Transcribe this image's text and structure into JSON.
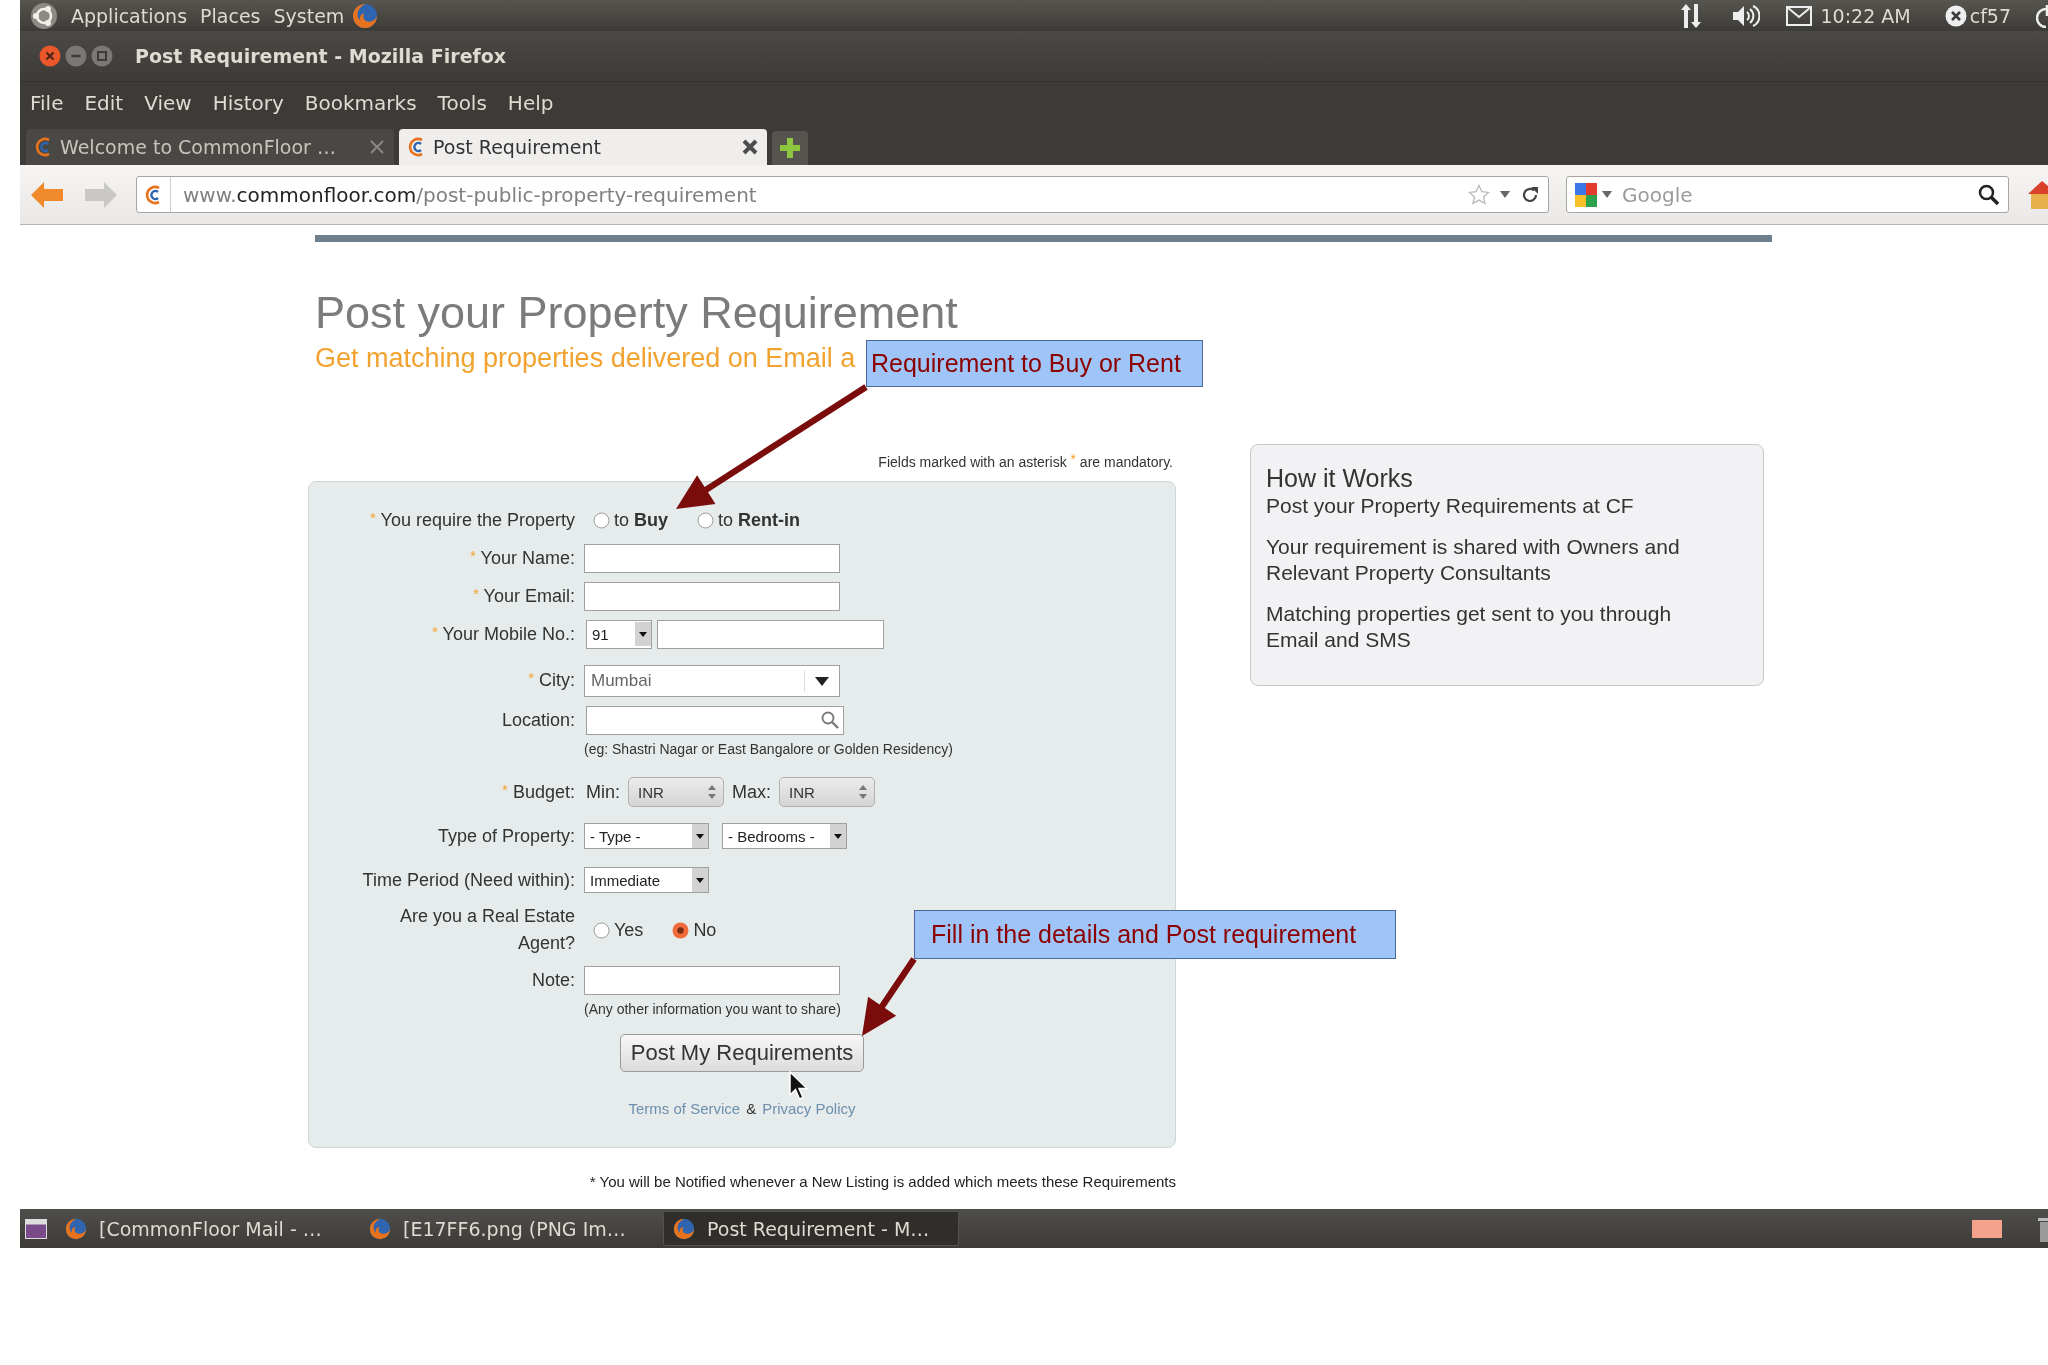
{
  "top_panel": {
    "menus": [
      "Applications",
      "Places",
      "System"
    ],
    "clock": "10:22 AM",
    "user": "cf57"
  },
  "window": {
    "title": "Post Requirement - Mozilla Firefox"
  },
  "menu_bar": [
    "File",
    "Edit",
    "View",
    "History",
    "Bookmarks",
    "Tools",
    "Help"
  ],
  "tabs": [
    {
      "label": "Welcome to CommonFloor …",
      "selected": false
    },
    {
      "label": "Post Requirement",
      "selected": true
    }
  ],
  "nav_buttons": [
    {
      "kind": "back",
      "disabled": false
    },
    {
      "kind": "forward",
      "disabled": true
    }
  ],
  "address_bar": {
    "url": [
      {
        "kind": "plain",
        "text": "www."
      },
      {
        "kind": "domain",
        "text": "commonfloor.com"
      },
      {
        "kind": "plain",
        "text": "/post-public-property-requirement"
      }
    ]
  },
  "search": {
    "placeholder": "Google"
  },
  "page": {
    "title": "Post your Property Requirement",
    "subtitle": "Get matching properties delivered on Email a",
    "mandatory_note": "Fields marked with an asterisk $^{*}$ are mandatory.",
    "form": {
      "rows": [
        {
          "kind": "radio",
          "label": "$^{*}$ You require the Property",
          "options": [
            {
              "label": "to **Buy**",
              "selected": false
            },
            {
              "label": "to **Rent-in**",
              "selected": false
            }
          ]
        },
        {
          "kind": "text",
          "label": "$^{*}$ Your Name:"
        },
        {
          "kind": "text",
          "label": "$^{*}$ Your Email:"
        },
        {
          "kind": "phone",
          "label": "$^{*}$ Your Mobile No.:",
          "code": "91"
        },
        {
          "kind": "combo",
          "label": "$^{*}$ City:",
          "value": "Mumbai"
        },
        {
          "kind": "search",
          "label": "Location:",
          "hint": "(eg: Shastri Nagar or East Bangalore or Golden Residency)"
        },
        {
          "kind": "budget",
          "label": "$^{*}$ Budget:",
          "ranges": [
            {
              "label": "Min:",
              "value": "INR"
            },
            {
              "label": "Max:",
              "value": "INR"
            }
          ]
        },
        {
          "kind": "selects",
          "label": "Type of Property:",
          "selects": [
            "- Type -",
            "- Bedrooms -"
          ]
        },
        {
          "kind": "selects",
          "label": "Time Period (Need within):",
          "selects": [
            "Immediate"
          ]
        },
        {
          "kind": "radio",
          "label": "Are you a Real Estate Agent?",
          "options": [
            {
              "label": "Yes",
              "selected": false
            },
            {
              "label": "No",
              "selected": true
            }
          ]
        },
        {
          "kind": "text",
          "label": "Note:",
          "hint": "(Any other information you want to share)"
        }
      ],
      "submit": "Post My Requirements",
      "links": [
        {
          "kind": "link",
          "text": "Terms of Service"
        },
        {
          "kind": "separator",
          "text": "&"
        },
        {
          "kind": "link",
          "text": "Privacy Policy"
        }
      ]
    },
    "footnote": "* You will be Notified whenever a New Listing is added which meets these Requirements",
    "how_it_works": {
      "heading": "How it Works",
      "steps": [
        "Post your Property Requirements at CF",
        "Your requirement is shared with Owners and Relevant Property Consultants",
        "Matching properties get sent to you through Email and SMS"
      ]
    }
  },
  "annotations": [
    {
      "text": "Requirement to Buy or Rent"
    },
    {
      "text": "Fill in the details and Post requirement"
    }
  ],
  "taskbar": {
    "items": [
      {
        "label": "[CommonFloor Mail - …",
        "selected": false
      },
      {
        "label": "[E17FF6.png (PNG Im…",
        "selected": false
      },
      {
        "label": "Post Requirement - M…",
        "selected": true
      }
    ]
  }
}
